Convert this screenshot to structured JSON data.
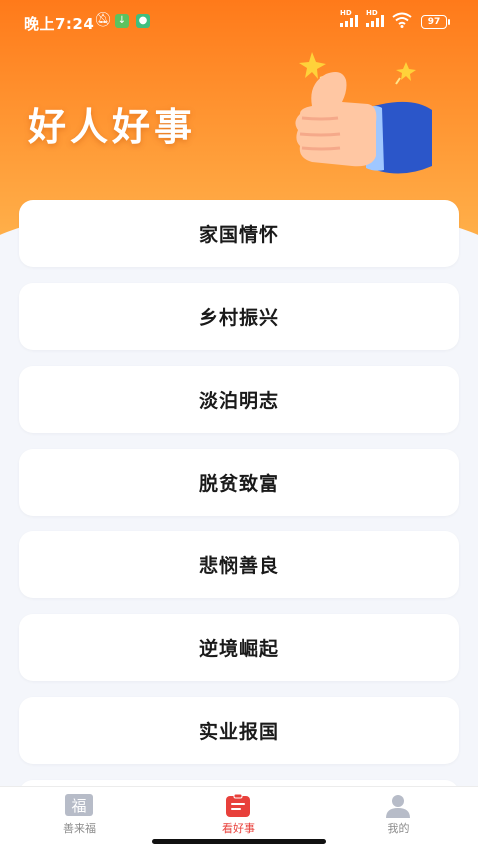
{
  "status_bar": {
    "time": "晚上7:24",
    "battery": "97",
    "signal1_label": "HD",
    "signal2_label": "HD",
    "wifi_icon": "wifi-icon",
    "mute_icon": "bell-off-icon"
  },
  "hero": {
    "title": "好人好事",
    "illustration": "thumbs-up-icon",
    "colors": {
      "gradient_top": "#ff7a1a",
      "gradient_bottom": "#ffb04a"
    }
  },
  "categories": [
    {
      "label": "家国情怀"
    },
    {
      "label": "乡村振兴"
    },
    {
      "label": "淡泊明志"
    },
    {
      "label": "脱贫致富"
    },
    {
      "label": "悲悯善良"
    },
    {
      "label": "逆境崛起"
    },
    {
      "label": "实业报国"
    }
  ],
  "tabbar": {
    "tabs": [
      {
        "label": "善来福",
        "icon": "fu-icon",
        "active": false
      },
      {
        "label": "看好事",
        "icon": "list-icon",
        "active": true
      },
      {
        "label": "我的",
        "icon": "user-icon",
        "active": false
      }
    ],
    "active_color": "#e8403b"
  }
}
